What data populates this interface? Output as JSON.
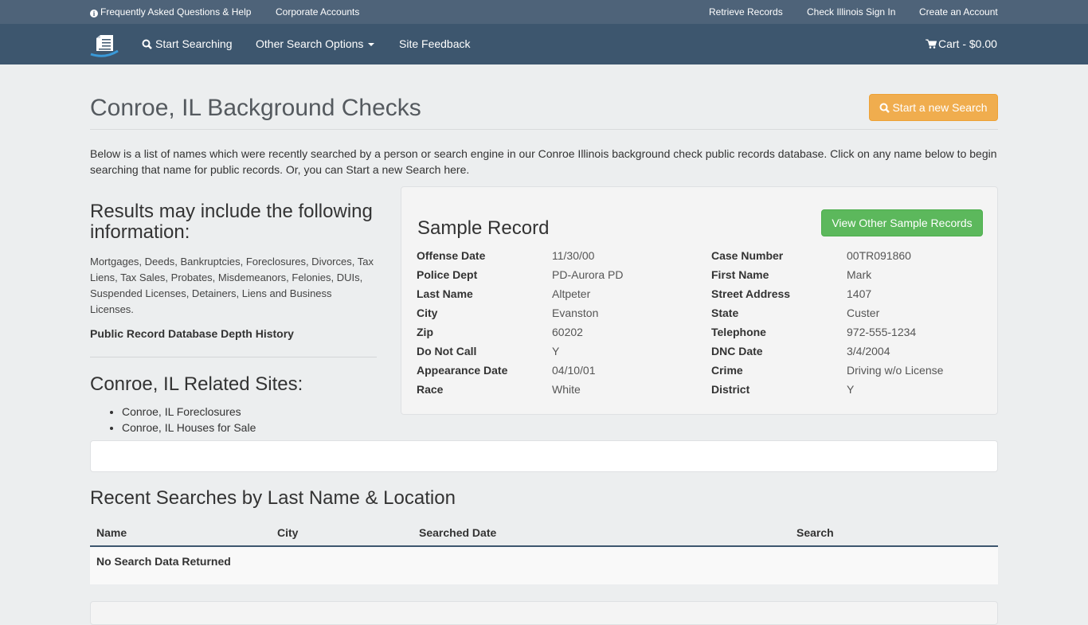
{
  "topbar": {
    "faq": "Frequently Asked Questions & Help",
    "corporate": "Corporate Accounts",
    "retrieve": "Retrieve Records",
    "signin": "Check Illinois Sign In",
    "create": "Create an Account"
  },
  "navbar": {
    "start": "Start Searching",
    "other": "Other Search Options",
    "feedback": "Site Feedback",
    "cart": "Cart - $0.00"
  },
  "header": {
    "title": "Conroe, IL Background Checks",
    "new_search": "Start a new Search"
  },
  "intro": "Below is a list of names which were recently searched by a person or search engine in our Conroe Illinois background check public records database. Click on any name below to begin searching that name for public records. Or, you can Start a new Search here.",
  "info": {
    "title": "Results may include the following information:",
    "list": "Mortgages, Deeds, Bankruptcies, Foreclosures, Divorces, Tax Liens, Tax Sales, Probates, Misdemeanors, Felonies, DUIs, Suspended Licenses, Detainers, Liens and Business Licenses.",
    "depth_link": "Public Record Database Depth History"
  },
  "related": {
    "title": "Conroe, IL Related Sites:",
    "items": [
      "Conroe, IL Foreclosures",
      "Conroe, IL Houses for Sale"
    ]
  },
  "sample": {
    "title": "Sample Record",
    "button": "View Other Sample Records",
    "left": [
      {
        "label": "Offense Date",
        "value": "11/30/00"
      },
      {
        "label": "Police Dept",
        "value": "PD-Aurora PD"
      },
      {
        "label": "Last Name",
        "value": "Altpeter"
      },
      {
        "label": "City",
        "value": "Evanston"
      },
      {
        "label": "Zip",
        "value": "60202"
      },
      {
        "label": "Do Not Call",
        "value": "Y"
      },
      {
        "label": "Appearance Date",
        "value": "04/10/01"
      },
      {
        "label": "Race",
        "value": "White"
      }
    ],
    "right": [
      {
        "label": "Case Number",
        "value": "00TR091860"
      },
      {
        "label": "First Name",
        "value": "Mark"
      },
      {
        "label": "Street Address",
        "value": "1407"
      },
      {
        "label": "State",
        "value": "Custer"
      },
      {
        "label": "Telephone",
        "value": "972-555-1234"
      },
      {
        "label": "DNC Date",
        "value": "3/4/2004"
      },
      {
        "label": "Crime",
        "value": "Driving w/o License"
      },
      {
        "label": "District",
        "value": "Y"
      }
    ]
  },
  "recent": {
    "title": "Recent Searches by Last Name & Location",
    "columns": [
      "Name",
      "City",
      "Searched Date",
      "Search"
    ],
    "empty": "No Search Data Returned"
  },
  "colors": {
    "topbar": "#4e6379",
    "navbar": "#3d566e",
    "warning": "#f0ad4e",
    "success": "#5cb85c",
    "background": "#eceeef"
  }
}
